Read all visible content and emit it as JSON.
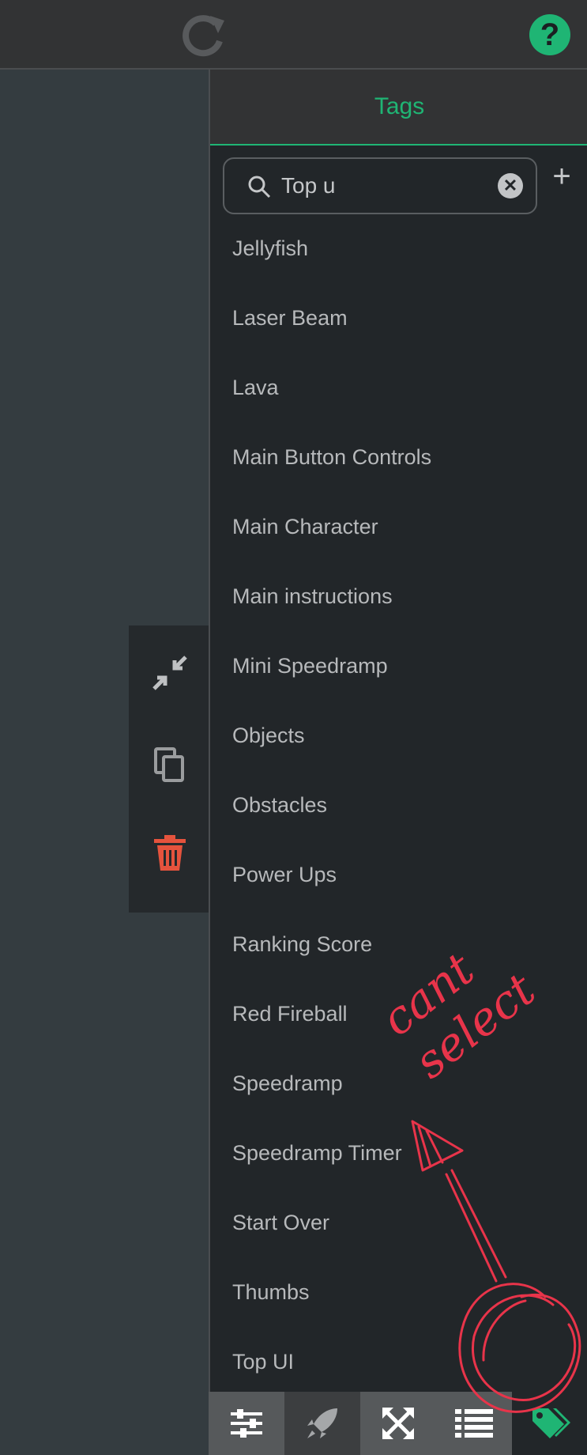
{
  "topbar": {
    "refresh_icon": "refresh-icon",
    "help_icon": "help-icon"
  },
  "side_tools": [
    "collapse-icon",
    "copy-icon",
    "trash-icon"
  ],
  "tags_panel": {
    "title": "Tags",
    "search": {
      "value": "Top u",
      "clear_icon": "clear-icon"
    },
    "add_icon": "plus-icon",
    "items": [
      "Jellyfish",
      "Laser Beam",
      "Lava",
      "Main Button Controls",
      "Main Character",
      "Main instructions",
      "Mini Speedramp",
      "Objects",
      "Obstacles",
      "Power Ups",
      "Ranking Score",
      "Red Fireball",
      "Speedramp",
      "Speedramp Timer",
      "Start Over",
      "Thumbs",
      "Top UI"
    ]
  },
  "bottom_tabs": [
    "sliders-icon",
    "rocket-icon",
    "expand-icon",
    "list-icon",
    "tag-icon"
  ],
  "colors": {
    "accent": "#1fb574",
    "danger": "#e5533d",
    "annotation": "#e8344a"
  },
  "annotation": {
    "text": "cant select"
  }
}
